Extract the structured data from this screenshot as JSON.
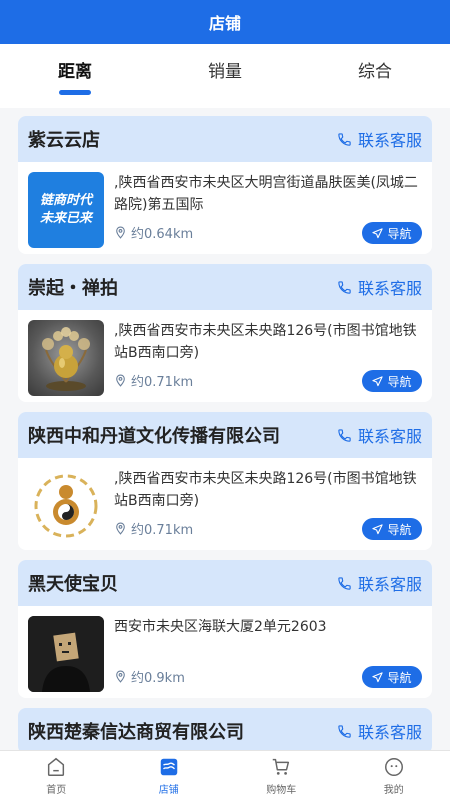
{
  "header": {
    "title": "店铺"
  },
  "tabs": [
    {
      "label": "距离",
      "active": true
    },
    {
      "label": "销量",
      "active": false
    },
    {
      "label": "综合",
      "active": false
    }
  ],
  "contact_label": "联系客服",
  "nav_label": "导航",
  "stores": [
    {
      "name": "紫云云店",
      "address": ",陕西省西安市未央区大明宫街道晶肤医美(凤城二路院)第五国际",
      "distance": "约0.64km",
      "thumb": "brand-logo",
      "thumb_text_1": "链商时代",
      "thumb_text_2": "未来已来"
    },
    {
      "name": "崇起・禅拍",
      "address": ",陕西省西安市未央区未央路126号(市图书馆地铁站B西南口旁)",
      "distance": "约0.71km",
      "thumb": "gourd-ornament"
    },
    {
      "name": "陕西中和丹道文化传播有限公司",
      "address": ",陕西省西安市未央区未央路126号(市图书馆地铁站B西南口旁)",
      "distance": "约0.71km",
      "thumb": "taiji-gourd-logo"
    },
    {
      "name": "黑天使宝贝",
      "address": "西安市未央区海联大厦2单元2603",
      "distance": "约0.9km",
      "thumb": "box-head-figure"
    },
    {
      "name": "陕西楚秦信达商贸有限公司",
      "address": "",
      "distance": "",
      "thumb": ""
    }
  ],
  "bottom_nav": [
    {
      "label": "首页",
      "icon": "home-icon",
      "active": false
    },
    {
      "label": "店铺",
      "icon": "store-icon",
      "active": true
    },
    {
      "label": "购物车",
      "icon": "cart-icon",
      "active": false
    },
    {
      "label": "我的",
      "icon": "profile-icon",
      "active": false
    }
  ],
  "colors": {
    "primary": "#1e6de6",
    "card_header": "#d6e6fb"
  }
}
